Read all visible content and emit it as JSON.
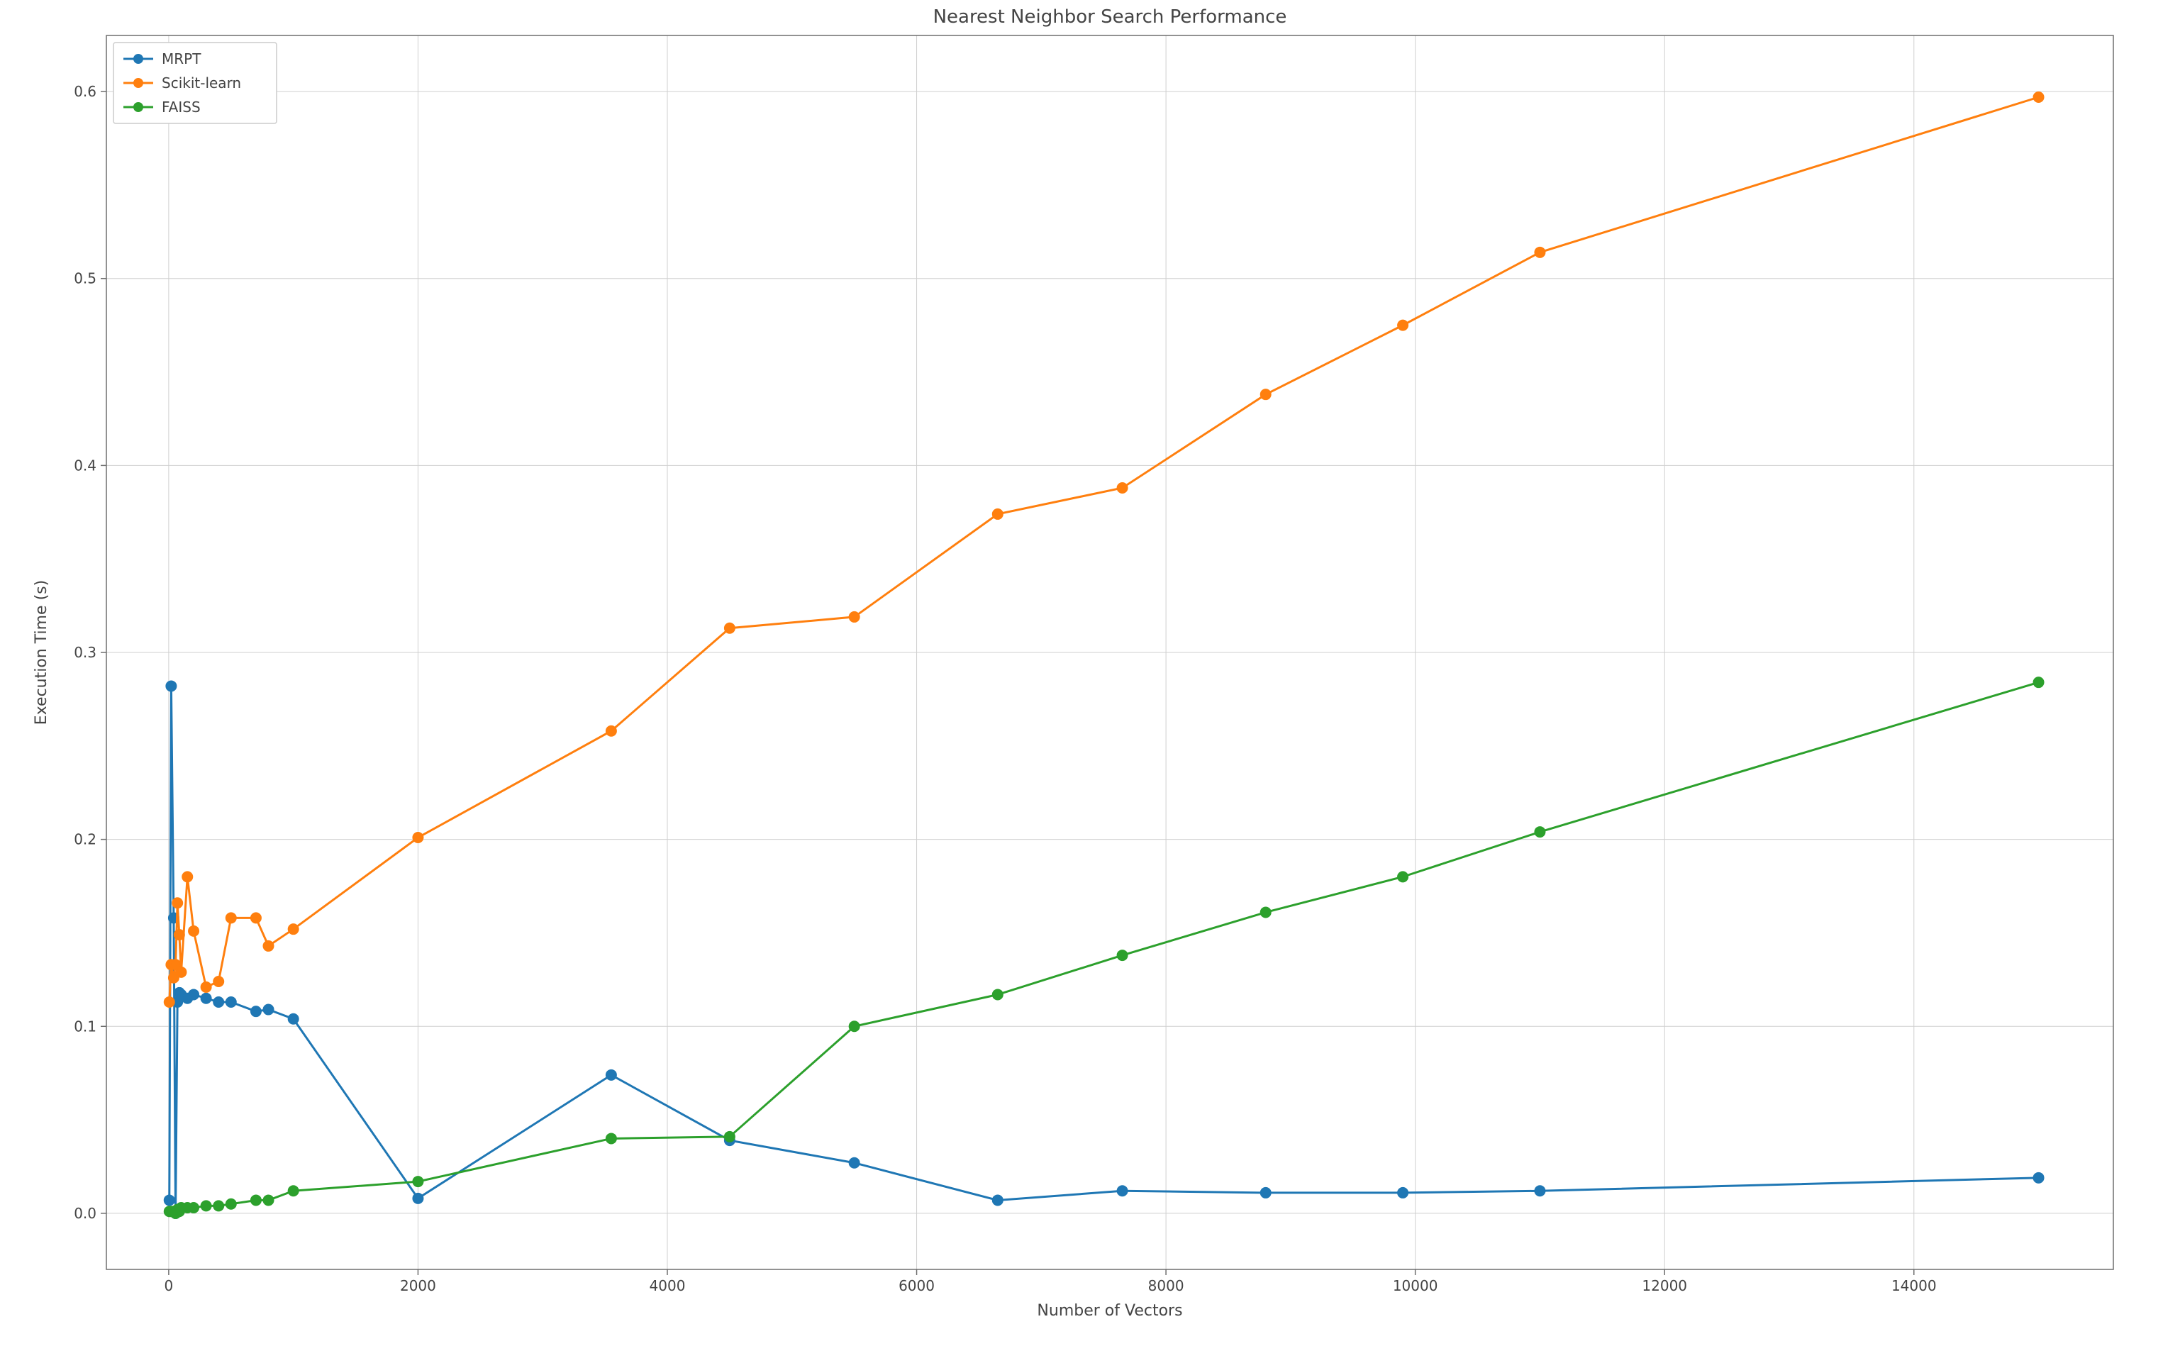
{
  "chart_data": {
    "type": "line",
    "title": "Nearest Neighbor Search Performance",
    "xlabel": "Number of Vectors",
    "ylabel": "Execution Time (s)",
    "xlim": [
      -500,
      15600
    ],
    "ylim": [
      -0.03,
      0.63
    ],
    "xticks": [
      0,
      2000,
      4000,
      6000,
      8000,
      10000,
      12000,
      14000
    ],
    "yticks": [
      0.0,
      0.1,
      0.2,
      0.3,
      0.4,
      0.5,
      0.6
    ],
    "x": [
      5,
      20,
      40,
      55,
      70,
      85,
      100,
      150,
      200,
      300,
      400,
      500,
      700,
      800,
      1000,
      2000,
      3550,
      4500,
      5500,
      6650,
      7650,
      8800,
      9900,
      11000,
      15000
    ],
    "series": [
      {
        "name": "MRPT",
        "color": "#1f77b4",
        "values": [
          0.007,
          0.282,
          0.158,
          0.0,
          0.113,
          0.118,
          0.117,
          0.115,
          0.117,
          0.115,
          0.113,
          0.113,
          0.108,
          0.109,
          0.104,
          0.008,
          0.074,
          0.039,
          0.027,
          0.007,
          0.012,
          0.011,
          0.011,
          0.012,
          0.019
        ]
      },
      {
        "name": "Scikit-learn",
        "color": "#ff7f0e",
        "values": [
          0.113,
          0.133,
          0.126,
          0.133,
          0.166,
          0.149,
          0.129,
          0.18,
          0.151,
          0.121,
          0.124,
          0.158,
          0.158,
          0.143,
          0.152,
          0.201,
          0.258,
          0.313,
          0.319,
          0.374,
          0.388,
          0.438,
          0.475,
          0.514,
          0.597
        ]
      },
      {
        "name": "FAISS",
        "color": "#2ca02c",
        "values": [
          0.001,
          0.001,
          0.001,
          0.0,
          0.002,
          0.001,
          0.003,
          0.003,
          0.003,
          0.004,
          0.004,
          0.005,
          0.007,
          0.007,
          0.012,
          0.017,
          0.04,
          0.041,
          0.1,
          0.117,
          0.138,
          0.161,
          0.18,
          0.204,
          0.284
        ]
      }
    ],
    "legend_position": "upper-left",
    "grid": true
  }
}
